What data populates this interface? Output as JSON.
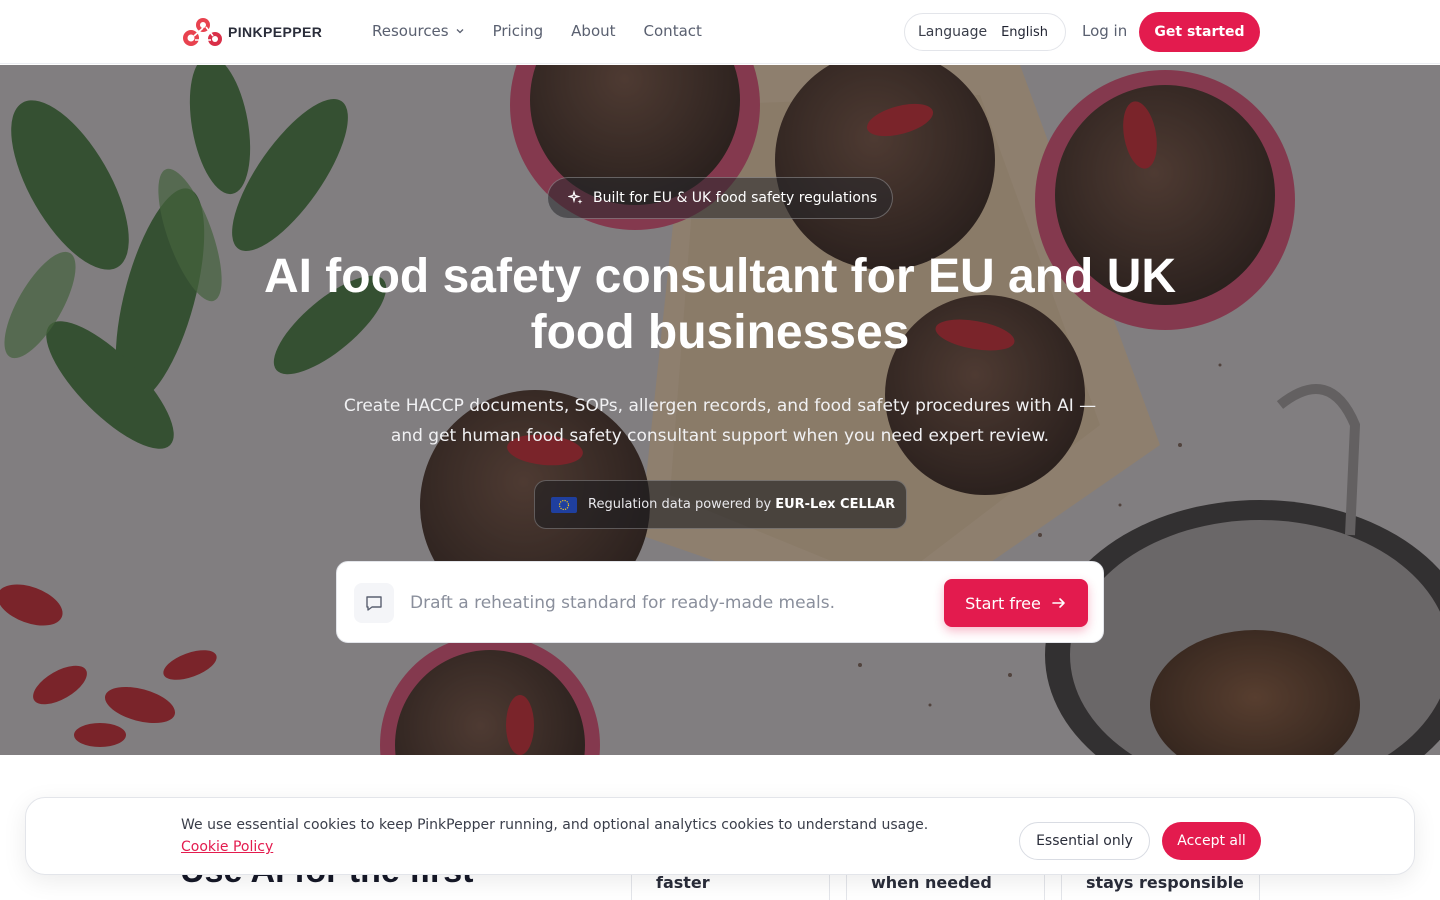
{
  "brand": {
    "name": "PINKPEPPER",
    "accent_color": "#e31b4e"
  },
  "nav": {
    "links": [
      {
        "label": "Resources",
        "has_dropdown": true
      },
      {
        "label": "Pricing"
      },
      {
        "label": "About"
      },
      {
        "label": "Contact"
      }
    ],
    "language": {
      "label": "Language",
      "value": "English"
    },
    "login_label": "Log in",
    "cta_label": "Get started"
  },
  "hero": {
    "badge": "Built for EU & UK food safety regulations",
    "title": "AI food safety consultant for EU and UK food businesses",
    "subtitle": "Create HACCP documents, SOPs, allergen records, and food safety procedures with AI — and get human food safety consultant support when you need expert review.",
    "powered_prefix": "Regulation data powered by",
    "powered_source": "EUR-Lex CELLAR",
    "search_placeholder": "Draft a reheating standard for ready-made meals.",
    "start_label": "Start free"
  },
  "below": {
    "heading": "Use AI for the first",
    "cards": [
      "faster",
      "when needed",
      "stays responsible"
    ]
  },
  "cookie": {
    "text": "We use essential cookies to keep PinkPepper running, and optional analytics cookies to understand usage.",
    "link_label": "Cookie Policy",
    "essential_label": "Essential only",
    "accept_label": "Accept all"
  }
}
